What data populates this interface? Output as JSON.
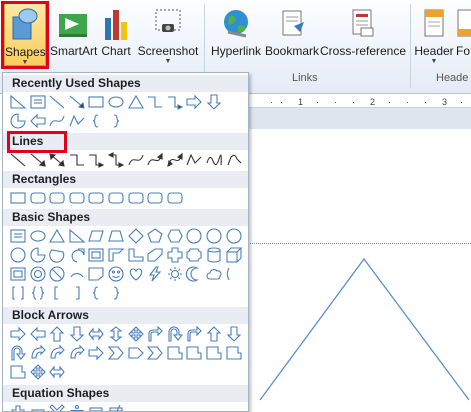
{
  "ribbon": {
    "shapes_label": "Shapes",
    "smartart_label": "SmartArt",
    "chart_label": "Chart",
    "screenshot_label": "Screenshot",
    "hyperlink_label": "Hyperlink",
    "bookmark_label": "Bookmark",
    "crossref_label": "Cross-reference",
    "header_label": "Header",
    "footer_label": "Fo",
    "links_group": "Links",
    "header_group": "Heade"
  },
  "ruler": {
    "labels": [
      "1",
      "2",
      "3"
    ]
  },
  "menu": {
    "sections": [
      {
        "title": "Recently Used Shapes"
      },
      {
        "title": "Lines"
      },
      {
        "title": "Rectangles"
      },
      {
        "title": "Basic Shapes"
      },
      {
        "title": "Block Arrows"
      },
      {
        "title": "Equation Shapes"
      }
    ]
  },
  "colors": {
    "highlight": "#e3001b",
    "shape_outline": "#4a7ebb",
    "triangle": "#5b8fcd"
  }
}
